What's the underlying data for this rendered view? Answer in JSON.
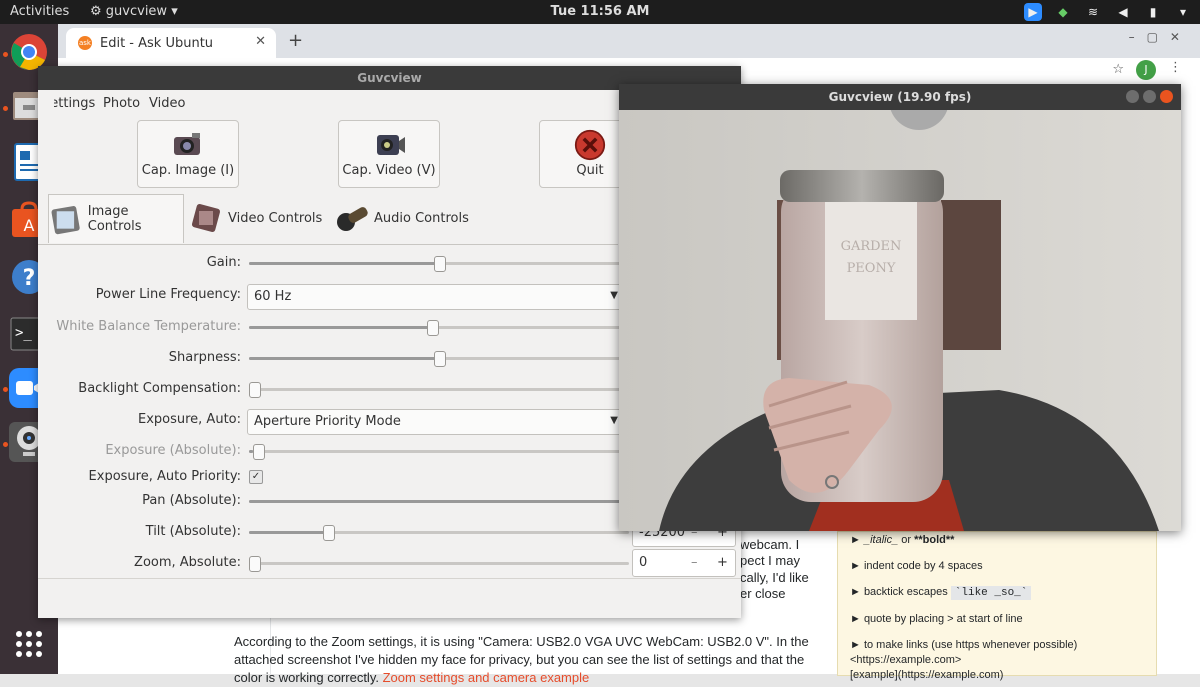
{
  "topbar": {
    "activities": "Activities",
    "app_name": "guvcview",
    "clock": "Tue 11:56 AM"
  },
  "browser": {
    "tab_title": "Edit - Ask Ubuntu",
    "tab_favicon_text": "ask",
    "avatar_letter": "J"
  },
  "page": {
    "fragments": [
      "webcam. I",
      "pect I may",
      "cally, I'd like",
      "er close"
    ],
    "paragraph_start": "According to the Zoom settings, it is using \"Camera: USB2.0 VGA UVC WebCam: USB2.0 V\". In the attached screenshot I've hidden my face for privacy, but you can see the list of settings and that the color is working correctly. ",
    "paragraph_link": "Zoom settings and camera example",
    "help": {
      "italic_bold_prefix": "► ",
      "italic_text": "_italic_",
      "or_text": " or ",
      "bold_text": "**bold**",
      "indent": "► indent code by 4 spaces",
      "backtick_prefix": "► backtick escapes ",
      "backtick_code": "`like _so_`",
      "quote": "► quote by placing > at start of line",
      "links": "► to make links (use https whenever possible)",
      "links_example": "<https://example.com>",
      "links_example2": "[example](https://example.com)"
    }
  },
  "guvcview": {
    "title": "Guvcview",
    "menu": [
      "Settings",
      "Photo",
      "Video"
    ],
    "buttons": {
      "cap_image": "Cap. Image (I)",
      "cap_video": "Cap. Video (V)",
      "quit": "Quit"
    },
    "tabs": [
      "Image Controls",
      "Video Controls",
      "Audio Controls"
    ],
    "controls": [
      {
        "label": "Gain:",
        "kind": "slider",
        "level": 0.5,
        "dim": false
      },
      {
        "label": "Power Line Frequency:",
        "kind": "combo",
        "value": "60 Hz",
        "dim": false
      },
      {
        "label": "White Balance Temperature:",
        "kind": "slider",
        "level": 0.48,
        "dim": true
      },
      {
        "label": "Sharpness:",
        "kind": "slider",
        "level": 0.5,
        "dim": false
      },
      {
        "label": "Backlight Compensation:",
        "kind": "slider",
        "level": 0.0,
        "dim": false
      },
      {
        "label": "Exposure, Auto:",
        "kind": "combo",
        "value": "Aperture Priority Mode",
        "dim": false
      },
      {
        "label": "Exposure (Absolute):",
        "kind": "slider",
        "level": 0.01,
        "dim": true
      },
      {
        "label": "Exposure, Auto Priority:",
        "kind": "checkbox",
        "checked": true,
        "dim": false
      },
      {
        "label": "Pan (Absolute):",
        "kind": "slider",
        "level": 1.0,
        "dim": false
      },
      {
        "label": "Tilt (Absolute):",
        "kind": "slider",
        "level": 0.2,
        "dim": false,
        "spin": "-25200"
      },
      {
        "label": "Zoom, Absolute:",
        "kind": "slider",
        "level": 0.0,
        "dim": false,
        "spin": "0"
      }
    ]
  },
  "video_window": {
    "title": "Guvcview  (19.90 fps)",
    "jar_label_line1": "GARDEN",
    "jar_label_line2": "PEONY"
  },
  "colors": {
    "accent": "#e95420",
    "dock": "#3a3036",
    "topbar": "#1d1d1d"
  }
}
